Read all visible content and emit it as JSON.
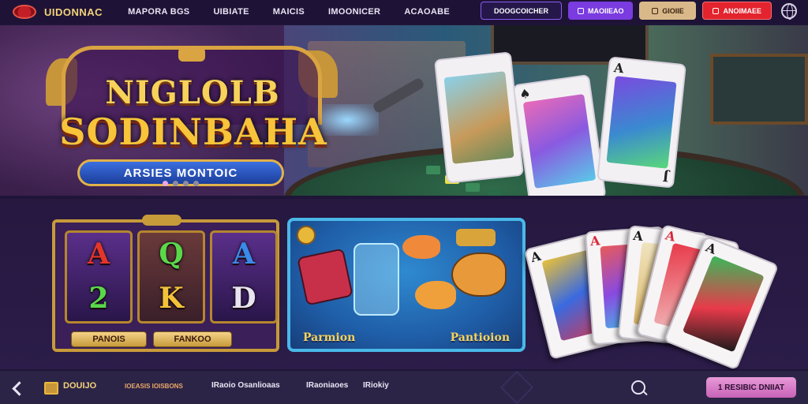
{
  "brand": {
    "name": "UIDONNAC"
  },
  "nav": {
    "links": [
      "MAPORA BGS",
      "UIBIATE",
      "MAICIS",
      "IMOONICER",
      "ACAOABE"
    ]
  },
  "actions": {
    "outline": "DOOGCOICHER",
    "purple": "MAOIIEAO",
    "tan": "GIOIIE",
    "red": "ANOIMAEE"
  },
  "hero": {
    "title_line1": "NIGLOLB",
    "title_line2": "SODINBAHA",
    "ribbon": "ARSIES MONTOIC",
    "card_ranks": [
      "A",
      "J"
    ],
    "slides": {
      "count": 4,
      "active": 1
    }
  },
  "slot_game": {
    "symbols": [
      "A",
      "Q",
      "A",
      "2",
      "K",
      "D"
    ],
    "labels": [
      "PANOIS",
      "FANKOO"
    ]
  },
  "fish_game": {
    "labels": [
      "Parmion",
      "Pantioion"
    ]
  },
  "cards_fan": {
    "ranks": [
      "A",
      "A",
      "A",
      "A",
      "A"
    ]
  },
  "bottom": {
    "home": "DOUIJO",
    "tag": "IOEASIS IOISBONS",
    "items": [
      "IRaoio Osanlioaas",
      "IRaoniaoes",
      "IRiokiy"
    ],
    "cta": "1 RESIBIC DNIIAT"
  },
  "colors": {
    "gold": "#f3d27a",
    "accent_purple": "#7a3be0",
    "accent_red": "#e3232d",
    "background": "#1f1538"
  }
}
